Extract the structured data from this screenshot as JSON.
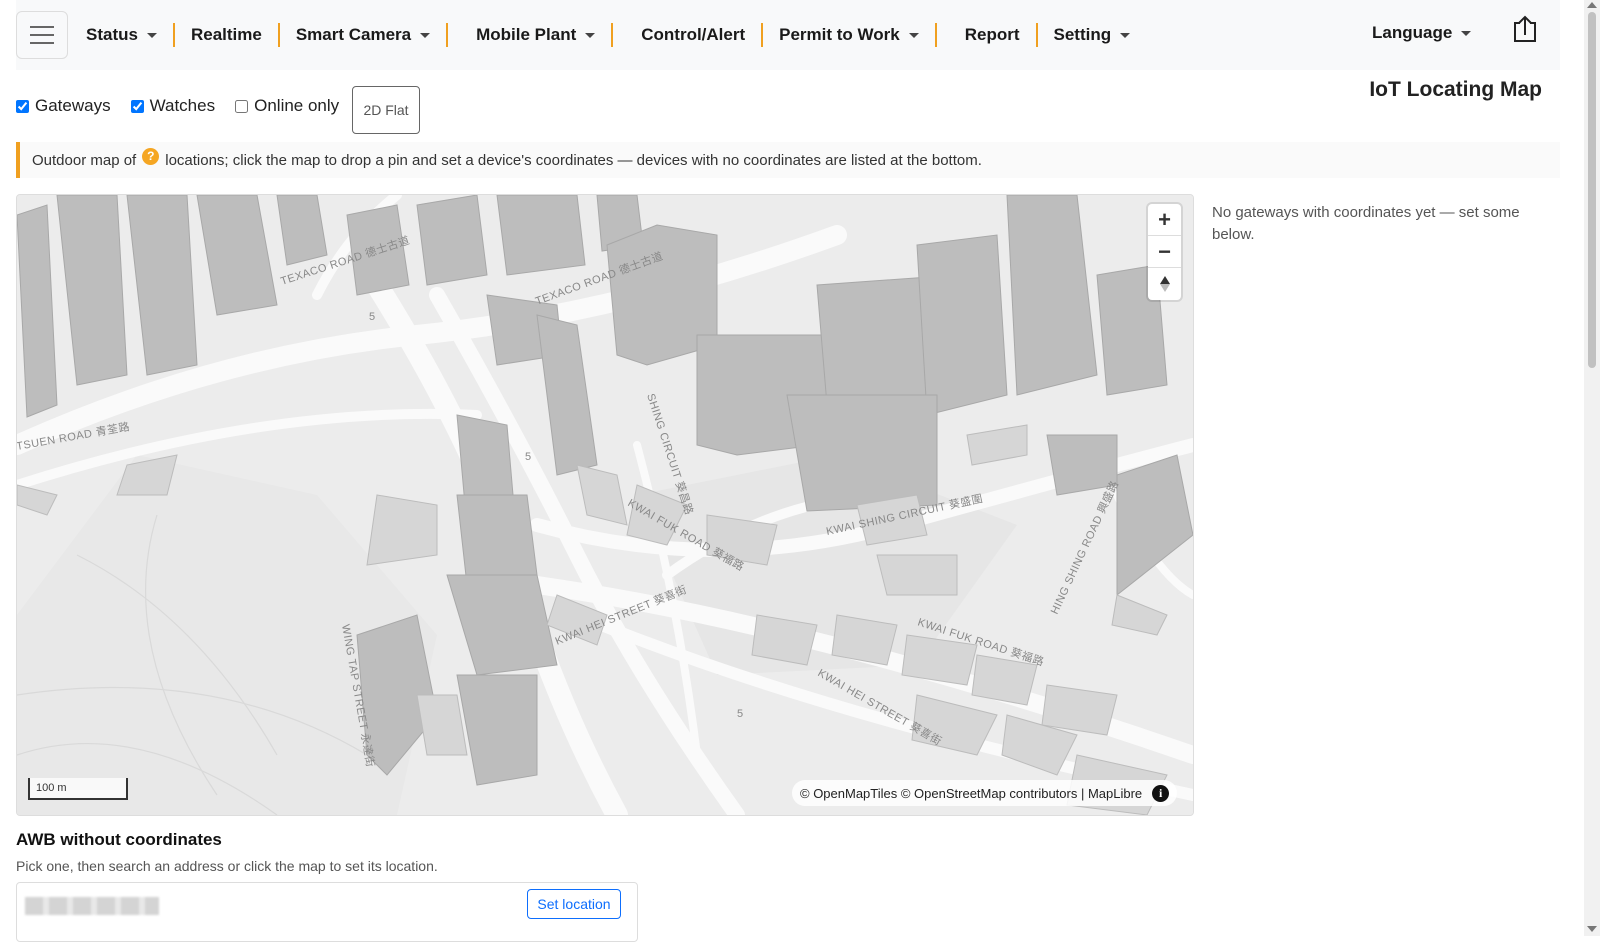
{
  "nav": {
    "items": [
      {
        "label": "Status",
        "dropdown": true
      },
      {
        "label": "Realtime",
        "dropdown": false
      },
      {
        "label": "Smart Camera",
        "dropdown": true
      },
      {
        "label": "Mobile Plant",
        "dropdown": true
      },
      {
        "label": "Control/Alert",
        "dropdown": false
      },
      {
        "label": "Permit to Work",
        "dropdown": true
      },
      {
        "label": "Report",
        "dropdown": false
      },
      {
        "label": "Setting",
        "dropdown": true
      }
    ],
    "language": "Language",
    "accent_color": "#f0a020"
  },
  "toolbar": {
    "gateways": {
      "label": "Gateways",
      "checked": true
    },
    "watches": {
      "label": "Watches",
      "checked": true
    },
    "online_only": {
      "label": "Online only",
      "checked": false
    },
    "view_mode_button": "2D Flat"
  },
  "page_title": "IoT Locating Map",
  "info": {
    "text_before": "Outdoor map of",
    "help_icon": "?",
    "text_after": "locations; click the map to drop a pin and set a device's coordinates — devices with no coordinates are listed at the bottom."
  },
  "map": {
    "zoom_in": "+",
    "zoom_out": "−",
    "scale_label": "100 m",
    "attribution": "© OpenMapTiles © OpenStreetMap contributors | MapLibre",
    "info_icon": "i",
    "street_labels": [
      "TEXACO ROAD 德士古道",
      "TEXACO ROAD 德士古道",
      "SHING CIRCUIT 葵昌路",
      "KWAI FUK ROAD 葵福路",
      "KWAI SHING CIRCUIT 葵盛圍",
      "KWAI HEI STREET 葵喜街",
      "KWAI FUK ROAD 葵福路",
      "KWAI HEI STREET 葵喜街",
      "WING TAP STREET 永達街",
      "TSUEN ROAD 青荃路",
      "HING SHING ROAD 興盛路",
      "5",
      "5",
      "5"
    ]
  },
  "side_note": "No gateways with coordinates yet — set some below.",
  "awb_section": {
    "title": "AWB without coordinates",
    "subtitle": "Pick one, then search an address or click the map to set its location.",
    "set_location_button": "Set location"
  }
}
